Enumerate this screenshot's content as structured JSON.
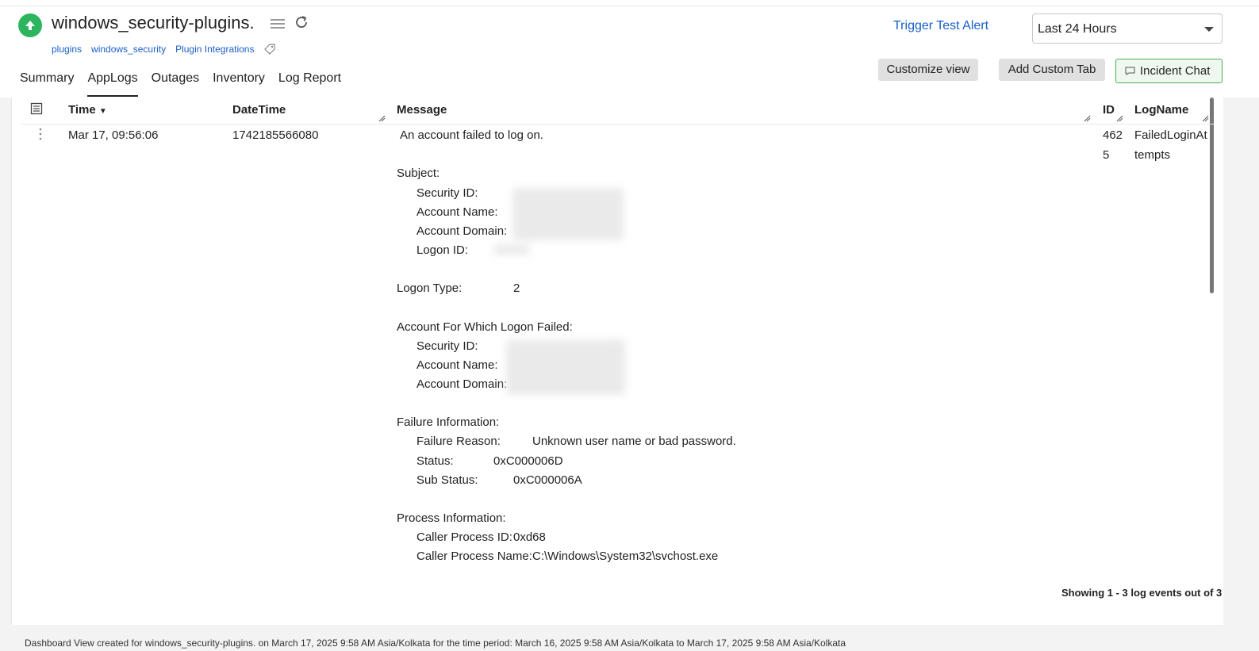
{
  "monitor": {
    "name": "windows_security-plugins.",
    "status": "up",
    "tags": [
      "plugins",
      "windows_security",
      "Plugin Integrations"
    ]
  },
  "tabs": [
    "Summary",
    "AppLogs",
    "Outages",
    "Inventory",
    "Log Report"
  ],
  "active_tab": "AppLogs",
  "header_actions": {
    "trigger_test_alert": "Trigger Test Alert",
    "time_range": "Last 24 Hours",
    "customize_view": "Customize view",
    "add_custom_tab": "Add Custom Tab",
    "incident_chat": "Incident Chat"
  },
  "table": {
    "columns": [
      "Time",
      "DateTime",
      "Message",
      "ID",
      "LogName"
    ],
    "row": {
      "time": "Mar 17, 09:56:06",
      "datetime": "1742185566080",
      "id_line1": "462",
      "id_line2": "5",
      "logname_line1": "FailedLoginAt",
      "logname_line2": "tempts",
      "message": {
        "summary": "An account failed to log on.",
        "subject_heading": "Subject:",
        "subject_security_id": "Security ID:",
        "subject_account_name": "Account Name:",
        "subject_account_domain": "Account Domain:",
        "subject_logon_id": "Logon ID:",
        "logon_type_label": "Logon Type:",
        "logon_type_value": "2",
        "failed_heading": "Account For Which Logon Failed:",
        "failed_security_id": "Security ID:",
        "failed_account_name": "Account Name:",
        "failed_account_domain": "Account Domain:",
        "failure_heading": "Failure Information:",
        "failure_reason_label": "Failure Reason:",
        "failure_reason_value": "Unknown user name or bad password.",
        "status_label": "Status:",
        "status_value": "0xC000006D",
        "sub_status_label": "Sub Status:",
        "sub_status_value": "0xC000006A",
        "process_heading": "Process Information:",
        "caller_pid_label": "Caller Process ID:",
        "caller_pid_value": "0xd68",
        "caller_name_label": "Caller Process Name:",
        "caller_name_value": "C:\\Windows\\System32\\svchost.exe"
      }
    },
    "showing": "Showing 1 - 3 log events out of 3"
  },
  "footer": {
    "text": "Dashboard View created for windows_security-plugins. on March 17, 2025 9:58 AM Asia/Kolkata for the time period: March 16, 2025 9:58 AM Asia/Kolkata to March 17, 2025 9:58 AM Asia/Kolkata"
  }
}
